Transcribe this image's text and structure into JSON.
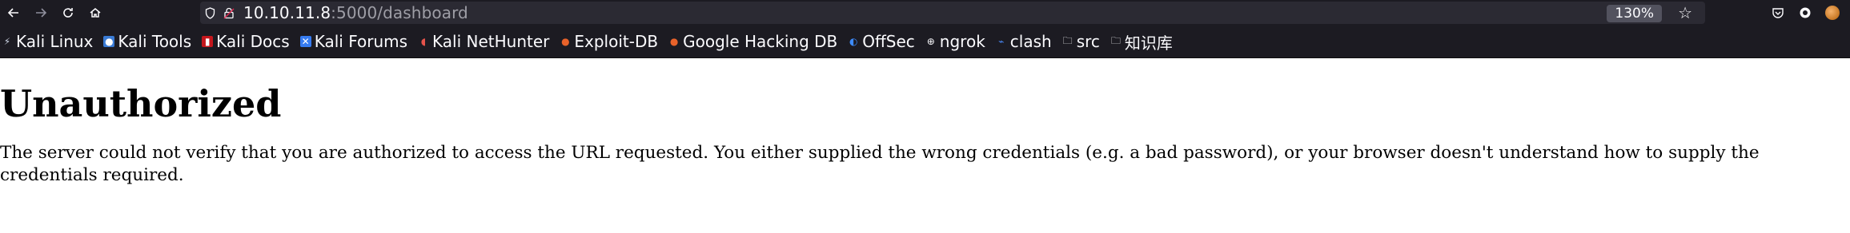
{
  "browser": {
    "url_host": "10.10.11.8",
    "url_path": ":5000/dashboard",
    "zoom": "130%"
  },
  "bookmarks": [
    {
      "label": "Kali Linux",
      "icon": "kali-dragon-icon"
    },
    {
      "label": "Kali Tools",
      "icon": "kali-tools-icon"
    },
    {
      "label": "Kali Docs",
      "icon": "kali-docs-icon"
    },
    {
      "label": "Kali Forums",
      "icon": "kali-forums-icon"
    },
    {
      "label": "Kali NetHunter",
      "icon": "nethunter-icon"
    },
    {
      "label": "Exploit-DB",
      "icon": "exploit-db-icon"
    },
    {
      "label": "Google Hacking DB",
      "icon": "ghdb-icon"
    },
    {
      "label": "OffSec",
      "icon": "offsec-icon"
    },
    {
      "label": "ngrok",
      "icon": "globe-icon"
    },
    {
      "label": "clash",
      "icon": "clash-icon"
    },
    {
      "label": "src",
      "icon": "folder-icon"
    },
    {
      "label": "知识库",
      "icon": "folder-icon"
    }
  ],
  "page": {
    "heading": "Unauthorized",
    "message": "The server could not verify that you are authorized to access the URL requested. You either supplied the wrong credentials (e.g. a bad password), or your browser doesn't understand how to supply the credentials required."
  }
}
